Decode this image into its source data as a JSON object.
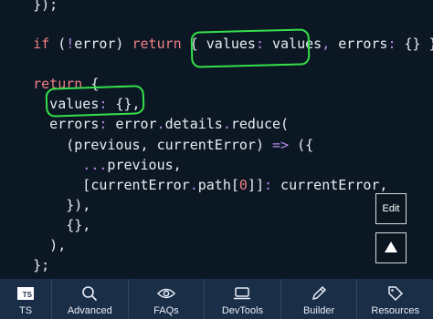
{
  "code": {
    "lines": [
      {
        "t": [
          [
            "pl",
            "    });"
          ]
        ]
      },
      {
        "t": []
      },
      {
        "t": [
          [
            "kw",
            "    if "
          ],
          [
            "pl",
            "("
          ],
          [
            "op",
            "!"
          ],
          [
            "pl",
            "error) "
          ],
          [
            "kw",
            "return"
          ],
          [
            "pl",
            " { values"
          ],
          [
            "op",
            ":"
          ],
          [
            "pl",
            " values"
          ],
          [
            "op",
            ","
          ],
          [
            "pl",
            " errors"
          ],
          [
            "op",
            ":"
          ],
          [
            "pl",
            " {} }"
          ]
        ]
      },
      {
        "t": []
      },
      {
        "t": [
          [
            "kw",
            "    return"
          ],
          [
            "pl",
            " {"
          ]
        ]
      },
      {
        "t": [
          [
            "pl",
            "      values"
          ],
          [
            "op",
            ":"
          ],
          [
            "pl",
            " {},"
          ]
        ]
      },
      {
        "t": [
          [
            "pl",
            "      errors"
          ],
          [
            "op",
            ":"
          ],
          [
            "pl",
            " error"
          ],
          [
            "op",
            "."
          ],
          [
            "pl",
            "details"
          ],
          [
            "op",
            "."
          ],
          [
            "pl",
            "reduce("
          ]
        ]
      },
      {
        "t": [
          [
            "pl",
            "        (previous, currentError) "
          ],
          [
            "op",
            "=>"
          ],
          [
            "pl",
            " ({"
          ]
        ]
      },
      {
        "t": [
          [
            "op",
            "          ..."
          ],
          [
            "pl",
            "previous,"
          ]
        ]
      },
      {
        "t": [
          [
            "pl",
            "          [currentError"
          ],
          [
            "op",
            "."
          ],
          [
            "pl",
            "path["
          ],
          [
            "idx",
            "0"
          ],
          [
            "pl",
            "]]"
          ],
          [
            "op",
            ":"
          ],
          [
            "pl",
            " currentError,"
          ]
        ]
      },
      {
        "t": [
          [
            "pl",
            "        }),"
          ]
        ]
      },
      {
        "t": [
          [
            "pl",
            "        {},"
          ]
        ]
      },
      {
        "t": [
          [
            "pl",
            "      ),"
          ]
        ]
      },
      {
        "t": [
          [
            "pl",
            "    };"
          ]
        ]
      },
      {
        "t": [
          [
            "pl",
            "  },"
          ]
        ]
      }
    ]
  },
  "side_buttons": {
    "edit_label": "Edit",
    "up_icon": "triangle-up-icon"
  },
  "nav": {
    "items": [
      {
        "label": "TS",
        "icon": "ts-badge-icon",
        "badge": "TS"
      },
      {
        "label": "Advanced",
        "icon": "search-icon"
      },
      {
        "label": "FAQs",
        "icon": "eye-icon"
      },
      {
        "label": "DevTools",
        "icon": "laptop-icon"
      },
      {
        "label": "Builder",
        "icon": "pencil-icon"
      },
      {
        "label": "Resources",
        "icon": "tag-icon"
      }
    ]
  },
  "colors": {
    "background": "#0b1824",
    "keyword": "#f07f86",
    "operator": "#b98be8",
    "text": "#e8edf2",
    "highlight": "#35e04b",
    "nav_bg": "#1a2e48"
  }
}
